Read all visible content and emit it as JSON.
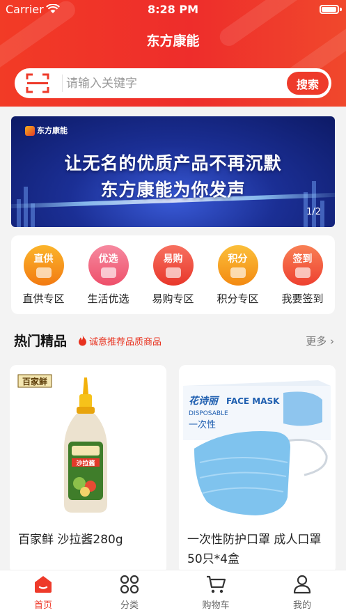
{
  "status_bar": {
    "carrier": "Carrier",
    "time": "8:28 PM"
  },
  "header": {
    "title": "东方康能"
  },
  "search": {
    "placeholder": "请输入关键字",
    "button_label": "搜索"
  },
  "banner": {
    "logo_text": "东方康能",
    "line1": "让无名的优质产品不再沉默",
    "line2": "东方康能为你发声",
    "pager": "1/2"
  },
  "categories": [
    {
      "badge": "直供",
      "label": "直供专区",
      "color": "#f58a16"
    },
    {
      "badge": "优选",
      "label": "生活优选",
      "color": "#f0607a"
    },
    {
      "badge": "易购",
      "label": "易购专区",
      "color": "#ee4a3a"
    },
    {
      "badge": "积分",
      "label": "积分专区",
      "color": "#f5a019"
    },
    {
      "badge": "签到",
      "label": "我要签到",
      "color": "#f25a38"
    }
  ],
  "hot_section": {
    "title": "热门精品",
    "subtitle": "诚意推荐品质商品",
    "more_label": "更多"
  },
  "products": [
    {
      "name": "百家鲜 沙拉酱280g",
      "brand_mark": "百家鲜",
      "bottle_label": "沙拉酱"
    },
    {
      "name": "一次性防护口罩 成人口罩50只*4盒",
      "box_brand": "花诗丽",
      "box_text": "FACE MASK",
      "box_subtext": "DISPOSABLE",
      "box_cn": "一次性"
    }
  ],
  "tabbar": [
    {
      "label": "首页",
      "active": true
    },
    {
      "label": "分类",
      "active": false
    },
    {
      "label": "购物车",
      "active": false
    },
    {
      "label": "我的",
      "active": false
    }
  ],
  "colors": {
    "brand_red": "#ee3a2a",
    "header_red": "#f23b26"
  }
}
